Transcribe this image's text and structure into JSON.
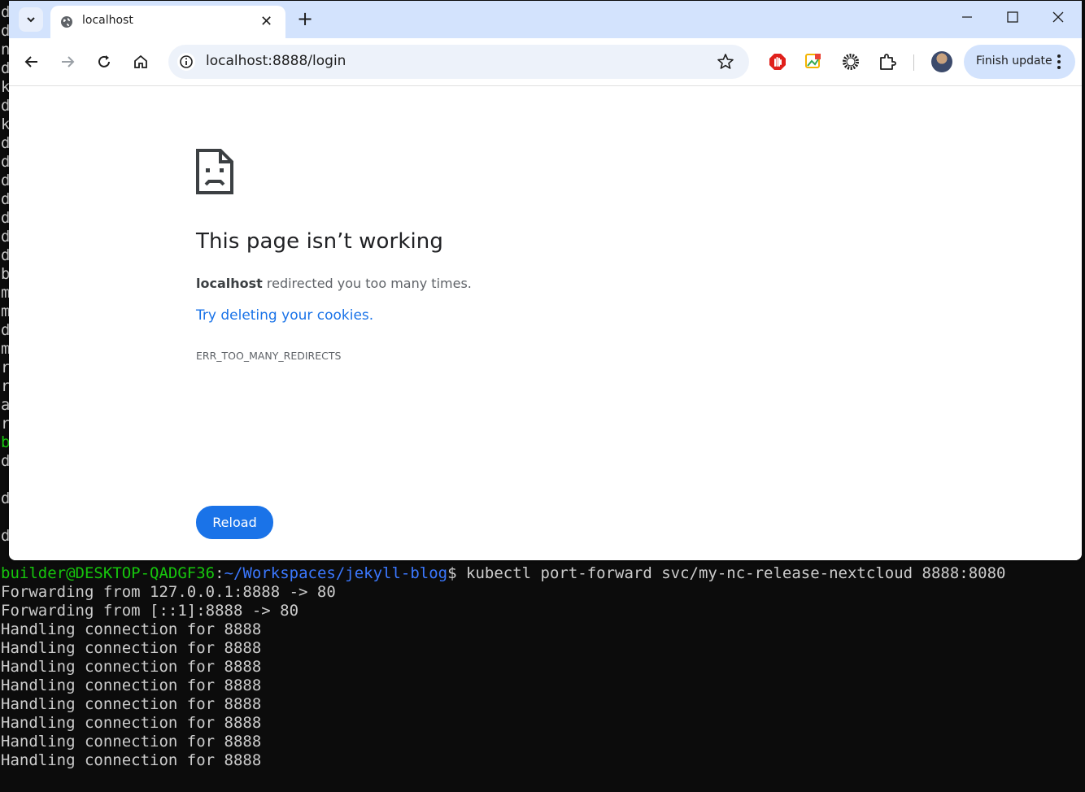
{
  "browser": {
    "tab": {
      "title": "localhost"
    },
    "address": {
      "url": "localhost:8888/login"
    },
    "finish_update_label": "Finish update"
  },
  "error_page": {
    "title": "This page isn’t working",
    "host": "localhost",
    "message": " redirected you too many times.",
    "suggestion": "Try deleting your cookies.",
    "code": "ERR_TOO_MANY_REDIRECTS",
    "reload_label": "Reload"
  },
  "terminal": {
    "left_column": [
      "d",
      "d",
      "n",
      "d",
      "k",
      "d",
      "k",
      "d",
      "d",
      "d",
      "d",
      "d",
      "d",
      "d",
      "b",
      "m",
      "m",
      "d",
      "m",
      "r",
      "r",
      "a",
      "r",
      "b",
      "d",
      "",
      "d",
      "",
      "d"
    ],
    "prompt_user": "builder@DESKTOP-QADGF36",
    "prompt_sep": ":",
    "prompt_path": "~/Workspaces/jekyll-blog",
    "prompt_symbol": "$ ",
    "command": "kubectl port-forward svc/my-nc-release-nextcloud 8888:8080",
    "output": [
      "Forwarding from 127.0.0.1:8888 -> 80",
      "Forwarding from [::1]:8888 -> 80",
      "Handling connection for 8888",
      "Handling connection for 8888",
      "Handling connection for 8888",
      "Handling connection for 8888",
      "Handling connection for 8888",
      "Handling connection for 8888",
      "Handling connection for 8888",
      "Handling connection for 8888"
    ]
  },
  "colors": {
    "accent": "#1a73e8",
    "tabbar": "#d3e3fd",
    "terminal_user": "#16c60c",
    "terminal_path": "#3b78ff"
  }
}
